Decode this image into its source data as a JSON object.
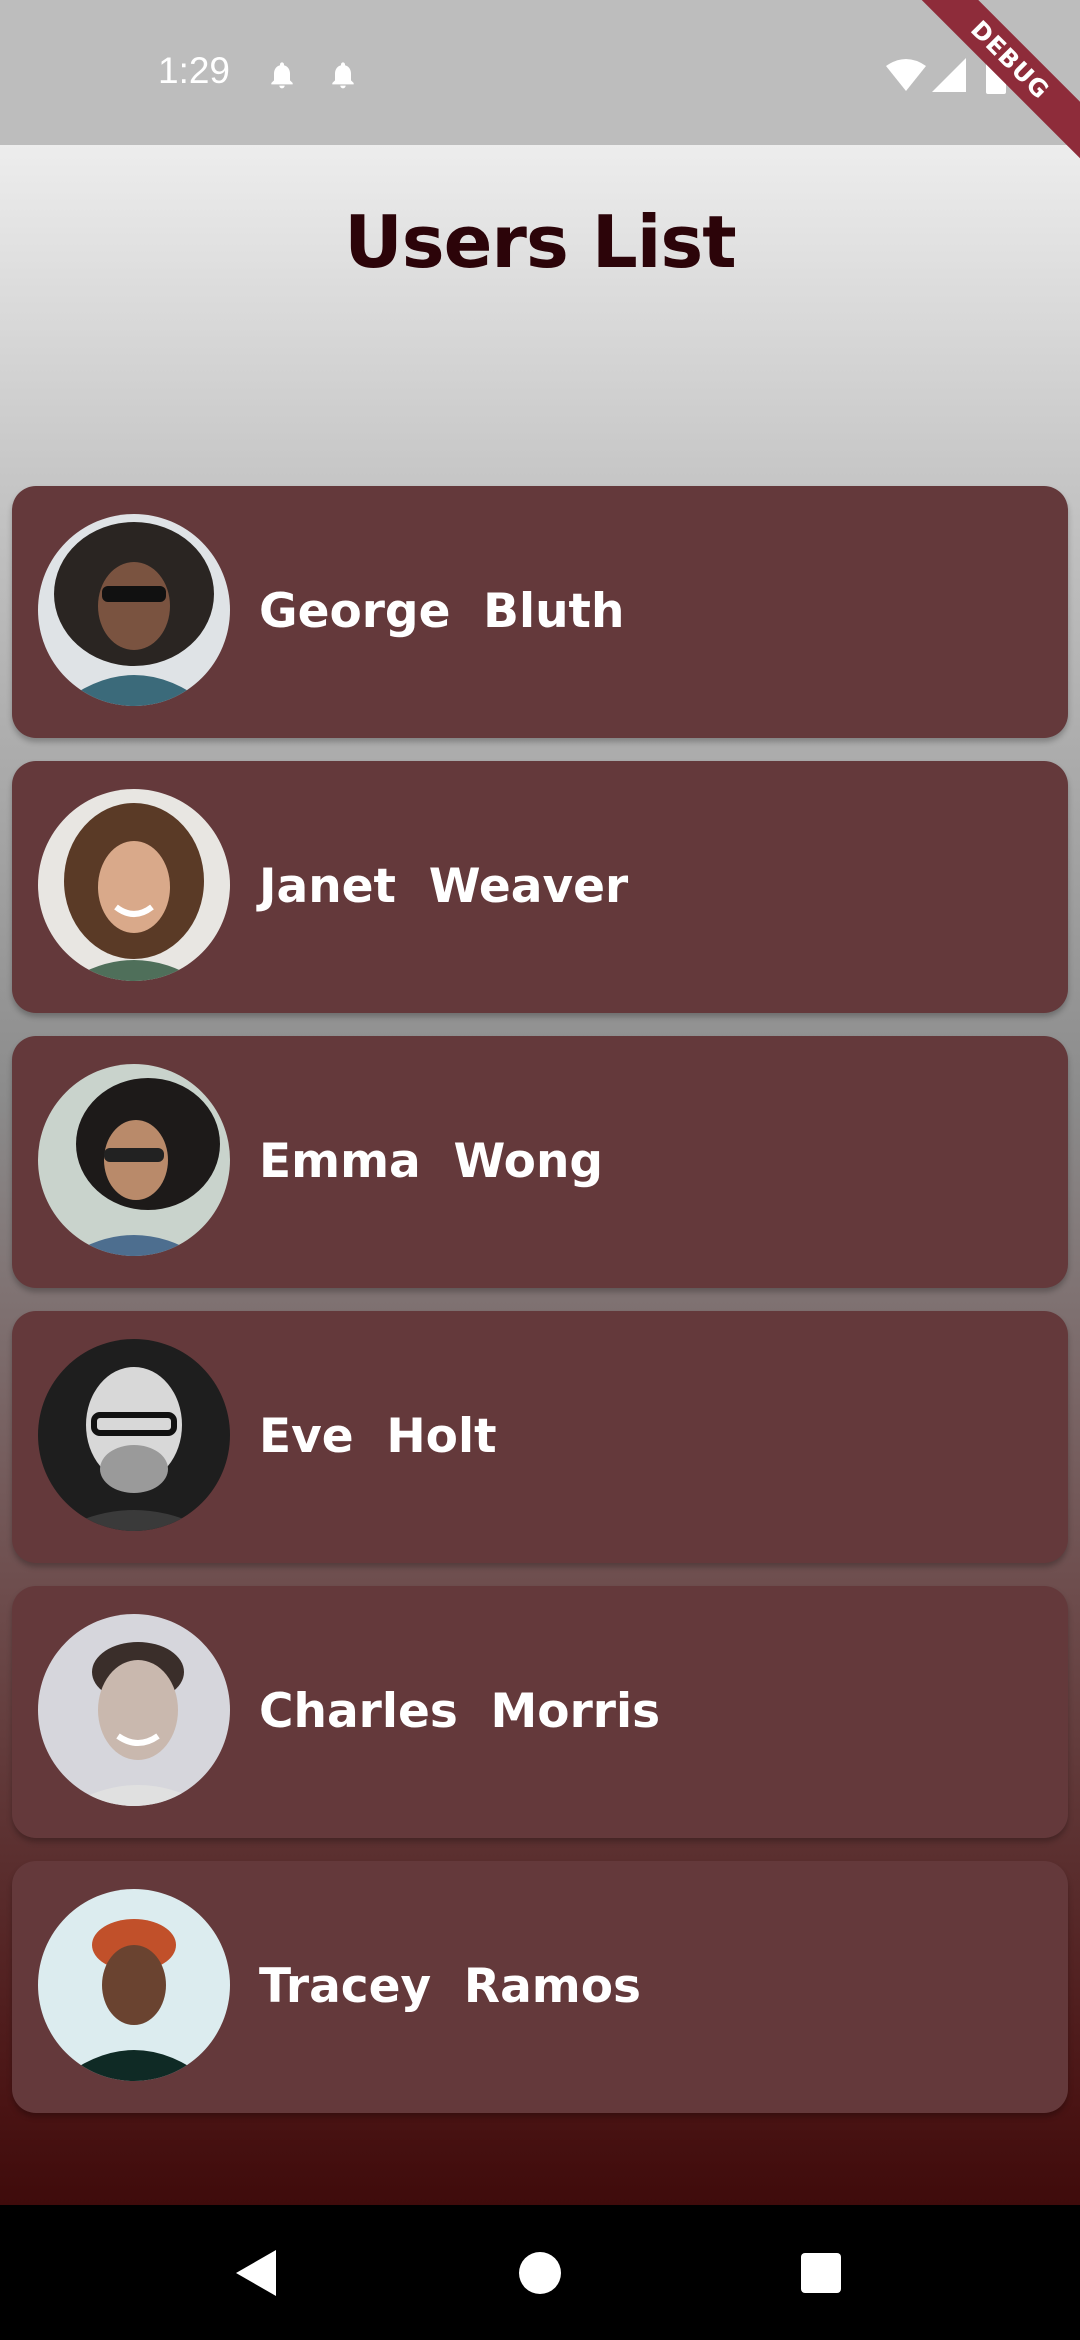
{
  "status_bar": {
    "time": "1:29",
    "icons": [
      "notification-bell-icon",
      "notification-bell-icon",
      "wifi-icon",
      "cell-signal-icon",
      "battery-icon"
    ]
  },
  "debug_banner": "DEBUG",
  "page": {
    "title": "Users List"
  },
  "users": [
    {
      "name": "George  Bluth",
      "avatar": "avatar-photo"
    },
    {
      "name": "Janet  Weaver",
      "avatar": "avatar-photo"
    },
    {
      "name": "Emma  Wong",
      "avatar": "avatar-photo"
    },
    {
      "name": "Eve  Holt",
      "avatar": "avatar-photo"
    },
    {
      "name": "Charles  Morris",
      "avatar": "avatar-photo"
    },
    {
      "name": "Tracey  Ramos",
      "avatar": "avatar-photo"
    }
  ],
  "nav_bar": {
    "buttons": [
      "back-icon",
      "home-icon",
      "recents-icon"
    ]
  },
  "colors": {
    "card": "#64393b",
    "title": "#2c0409",
    "name_text": "#ffffff"
  }
}
